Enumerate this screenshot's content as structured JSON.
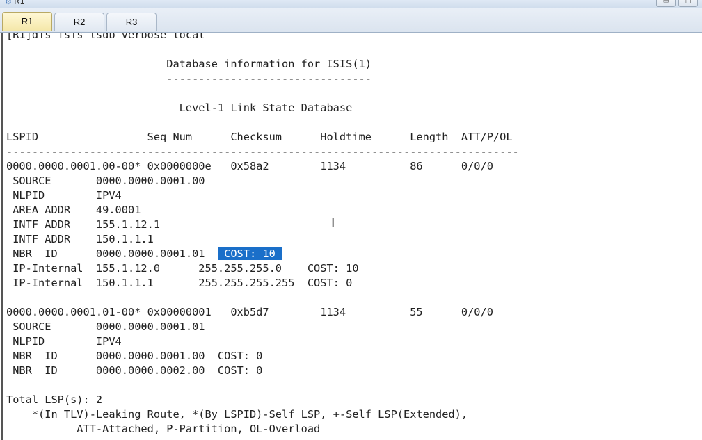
{
  "window": {
    "title": "R1"
  },
  "tabs": [
    {
      "label": "R1",
      "active": true
    },
    {
      "label": "R2",
      "active": false
    },
    {
      "label": "R3",
      "active": false
    }
  ],
  "terminal": {
    "lines": [
      "[R1]dis isis lsdb verbose local",
      "",
      "                         Database information for ISIS(1)",
      "                         --------------------------------",
      "",
      "                           Level-1 Link State Database",
      "",
      "LSPID                 Seq Num      Checksum      Holdtime      Length  ATT/P/OL",
      "--------------------------------------------------------------------------------",
      "0000.0000.0001.00-00* 0x0000000e   0x58a2        1134          86      0/0/0",
      " SOURCE       0000.0000.0001.00",
      " NLPID        IPV4",
      " AREA ADDR    49.0001",
      " INTF ADDR    155.1.12.1",
      " INTF ADDR    150.1.1.1",
      " NBR  ID      0000.0000.0001.01  COST: 10",
      " IP-Internal  155.1.12.0      255.255.255.0    COST: 10",
      " IP-Internal  150.1.1.1       255.255.255.255  COST: 0",
      "",
      "0000.0000.0001.01-00* 0x00000001   0xb5d7        1134          55      0/0/0",
      " SOURCE       0000.0000.0001.01",
      " NLPID        IPV4",
      " NBR  ID      0000.0000.0001.00  COST: 0",
      " NBR  ID      0000.0000.0002.00  COST: 0",
      "",
      "Total LSP(s): 2",
      "    *(In TLV)-Leaking Route, *(By LSPID)-Self LSP, +-Self LSP(Extended),",
      "           ATT-Attached, P-Partition, OL-Overload"
    ],
    "selection": {
      "line": 15,
      "text": "COST: 10"
    }
  }
}
